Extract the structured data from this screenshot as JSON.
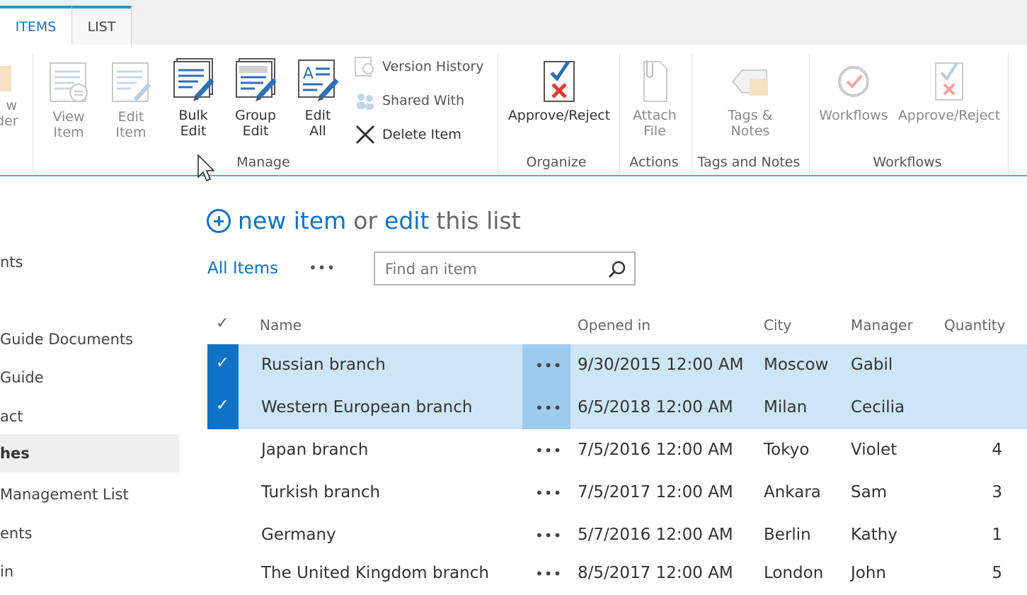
{
  "tabs": {
    "items": "ITEMS",
    "list": "LIST"
  },
  "ribbon": {
    "partial_left": [
      "w",
      "der"
    ],
    "manage": {
      "view_item": [
        "View",
        "Item"
      ],
      "edit_item": [
        "Edit",
        "Item"
      ],
      "bulk_edit": [
        "Bulk",
        "Edit"
      ],
      "group_edit": [
        "Group",
        "Edit"
      ],
      "edit_all": [
        "Edit",
        "All"
      ],
      "version_history": "Version History",
      "shared_with": "Shared With",
      "delete_item": "Delete Item",
      "group_label": "Manage"
    },
    "organize": {
      "approve_reject": "Approve/Reject",
      "group_label": "Organize"
    },
    "actions": {
      "attach_file": [
        "Attach",
        "File"
      ],
      "group_label": "Actions"
    },
    "tags": {
      "tags_notes": [
        "Tags &",
        "Notes"
      ],
      "group_label": "Tags and Notes"
    },
    "workflows": {
      "workflows": "Workflows",
      "approve_reject": "Approve/Reject",
      "group_label": "Workflows"
    }
  },
  "nav": [
    {
      "label": "nts",
      "selected": false
    },
    {
      "label": "Guide Documents",
      "selected": false
    },
    {
      "label": "Guide",
      "selected": false
    },
    {
      "label": "act",
      "selected": false
    },
    {
      "label": "hes",
      "selected": true
    },
    {
      "label": "Management List",
      "selected": false
    },
    {
      "label": "ents",
      "selected": false
    },
    {
      "label": "in",
      "selected": false
    }
  ],
  "heading": {
    "new_item": "new item",
    "or": "or",
    "edit": "edit",
    "this_list": "this list"
  },
  "views": {
    "all_items": "All Items",
    "more": "•••"
  },
  "search": {
    "placeholder": "Find an item",
    "value": ""
  },
  "table": {
    "select_all": "✓",
    "columns": {
      "name": "Name",
      "opened_in": "Opened in",
      "city": "City",
      "manager": "Manager",
      "quantity": "Quantity"
    },
    "rows": [
      {
        "name": "Russian branch",
        "opened": "9/30/2015 12:00 AM",
        "city": "Moscow",
        "manager": "Gabil",
        "quantity": "",
        "selected": true
      },
      {
        "name": "Western European branch",
        "opened": "6/5/2018 12:00 AM",
        "city": "Milan",
        "manager": "Cecilia",
        "quantity": "",
        "selected": true
      },
      {
        "name": "Japan branch",
        "opened": "7/5/2016 12:00 AM",
        "city": "Tokyo",
        "manager": "Violet",
        "quantity": "4",
        "selected": false
      },
      {
        "name": "Turkish branch",
        "opened": "7/5/2017 12:00 AM",
        "city": "Ankara",
        "manager": "Sam",
        "quantity": "3",
        "selected": false
      },
      {
        "name": "Germany",
        "opened": "5/7/2016 12:00 AM",
        "city": "Berlin",
        "manager": "Kathy",
        "quantity": "1",
        "selected": false
      },
      {
        "name": "The United Kingdom branch",
        "opened": "8/5/2017 12:00 AM",
        "city": "London",
        "manager": "John",
        "quantity": "5",
        "selected": false
      }
    ],
    "row_menu": "•••",
    "check_glyph": "✓"
  },
  "colors": {
    "accent": "#0f72c4",
    "selected_row": "#cde6f7",
    "tab_border": "#2f96c9"
  }
}
